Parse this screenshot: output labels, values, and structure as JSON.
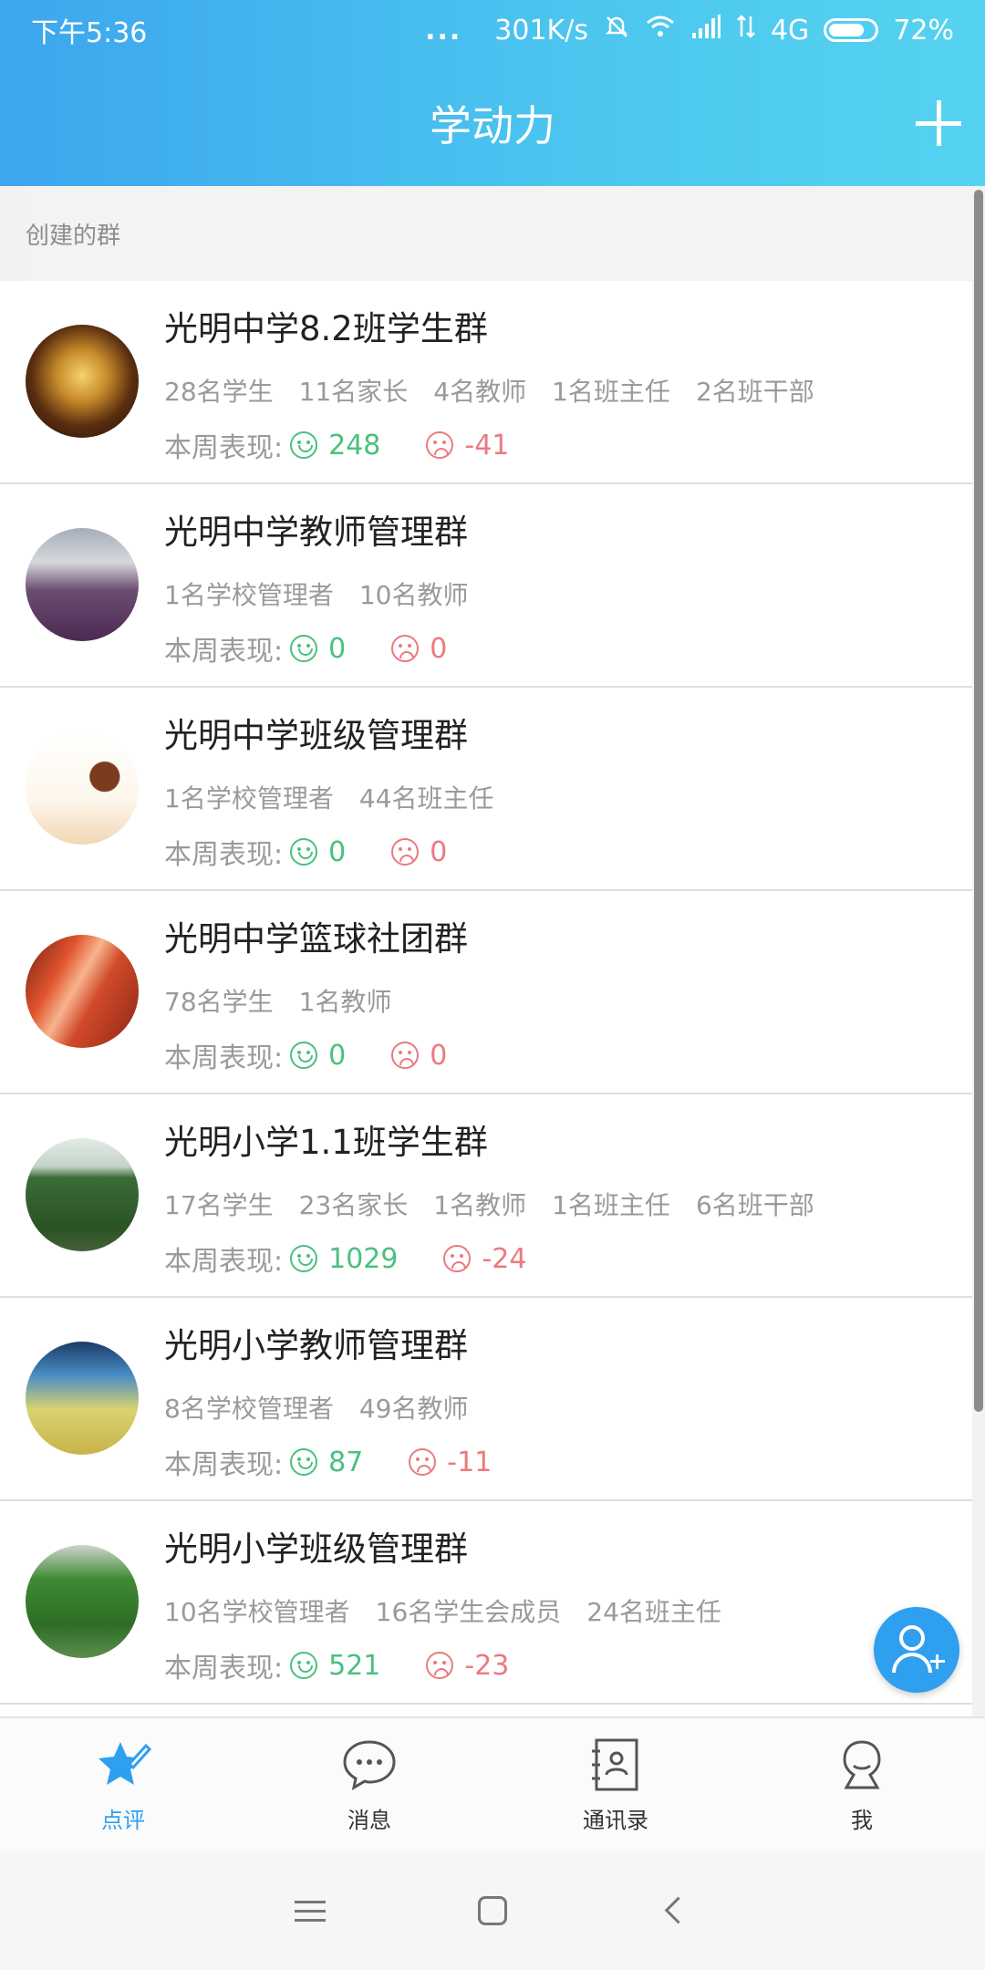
{
  "status_bar": {
    "time": "下午5:36",
    "dots": "...",
    "speed": "301K/s",
    "network": "4G",
    "battery": "72%"
  },
  "header": {
    "title": "学动力",
    "add_icon": "plus-icon"
  },
  "section": {
    "label": "创建的群"
  },
  "performance_label": "本周表现:",
  "groups": [
    {
      "name": "光明中学8.2班学生群",
      "members": [
        "28名学生",
        "11名家长",
        "4名教师",
        "1名班主任",
        "2名班干部"
      ],
      "positive": "248",
      "negative": "-41"
    },
    {
      "name": "光明中学教师管理群",
      "members": [
        "1名学校管理者",
        "10名教师"
      ],
      "positive": "0",
      "negative": "0"
    },
    {
      "name": "光明中学班级管理群",
      "members": [
        "1名学校管理者",
        "44名班主任"
      ],
      "positive": "0",
      "negative": "0"
    },
    {
      "name": "光明中学篮球社团群",
      "members": [
        "78名学生",
        "1名教师"
      ],
      "positive": "0",
      "negative": "0"
    },
    {
      "name": "光明小学1.1班学生群",
      "members": [
        "17名学生",
        "23名家长",
        "1名教师",
        "1名班主任",
        "6名班干部"
      ],
      "positive": "1029",
      "negative": "-24"
    },
    {
      "name": "光明小学教师管理群",
      "members": [
        "8名学校管理者",
        "49名教师"
      ],
      "positive": "87",
      "negative": "-11"
    },
    {
      "name": "光明小学班级管理群",
      "members": [
        "10名学校管理者",
        "16名学生会成员",
        "24名班主任"
      ],
      "positive": "521",
      "negative": "-23"
    }
  ],
  "tabs": [
    {
      "label": "点评",
      "icon": "star-pen-icon",
      "active": true
    },
    {
      "label": "消息",
      "icon": "chat-bubble-icon",
      "active": false
    },
    {
      "label": "通讯录",
      "icon": "contacts-book-icon",
      "active": false
    },
    {
      "label": "我",
      "icon": "person-icon",
      "active": false
    }
  ],
  "colors": {
    "header_start": "#3ca6ee",
    "header_end": "#55d3f0",
    "positive": "#49c17d",
    "negative": "#ea7a7f",
    "accent": "#2f9ff0"
  }
}
